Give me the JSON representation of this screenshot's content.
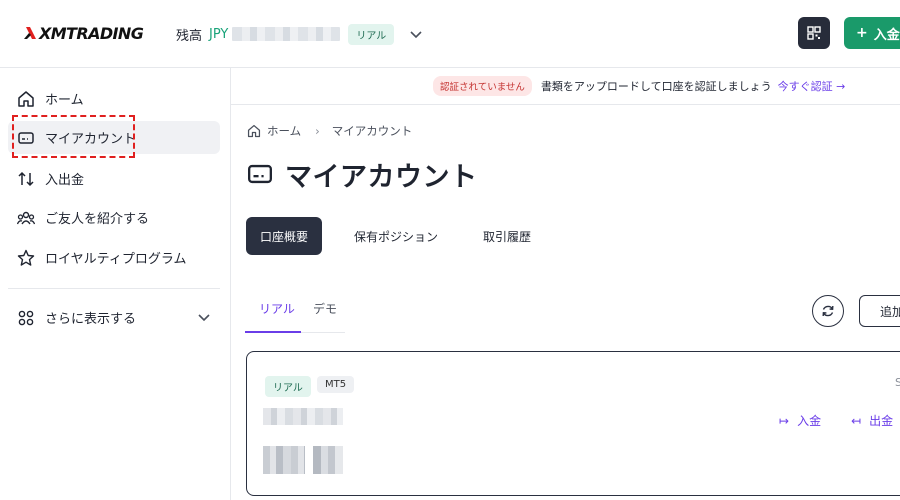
{
  "header": {
    "logo_text": "XMTRADING",
    "balance_label": "残高",
    "balance_currency": "JPY",
    "account_type_badge": "リアル",
    "deposit_button": "入金"
  },
  "sidebar": {
    "items": [
      {
        "label": "ホーム",
        "icon": "home-icon"
      },
      {
        "label": "マイアカウント",
        "icon": "card-icon"
      },
      {
        "label": "入出金",
        "icon": "transfer-icon"
      },
      {
        "label": "ご友人を紹介する",
        "icon": "users-icon"
      },
      {
        "label": "ロイヤルティプログラム",
        "icon": "star-icon"
      }
    ],
    "more_label": "さらに表示する"
  },
  "notice": {
    "badge": "認証されていません",
    "text": "書類をアップロードして口座を認証しましょう",
    "link": "今すぐ認証 →"
  },
  "breadcrumb": {
    "home": "ホーム",
    "current": "マイアカウント"
  },
  "page": {
    "title": "マイアカウント"
  },
  "tabs": [
    {
      "label": "口座概要",
      "active": true
    },
    {
      "label": "保有ポジション",
      "active": false
    },
    {
      "label": "取引履歴",
      "active": false
    }
  ],
  "subtabs": [
    {
      "label": "リアル",
      "active": true
    },
    {
      "label": "デモ",
      "active": false
    }
  ],
  "actions": {
    "add_label": "追加"
  },
  "account_card": {
    "tag_type": "リアル",
    "tag_platform": "MT5",
    "corner_text": "S",
    "deposit_label": "入金",
    "withdraw_label": "出金"
  },
  "colors": {
    "accent_purple": "#6a3de8",
    "brand_green": "#1a9a6a",
    "dark": "#2a3040",
    "highlight_red": "#e0201f"
  }
}
